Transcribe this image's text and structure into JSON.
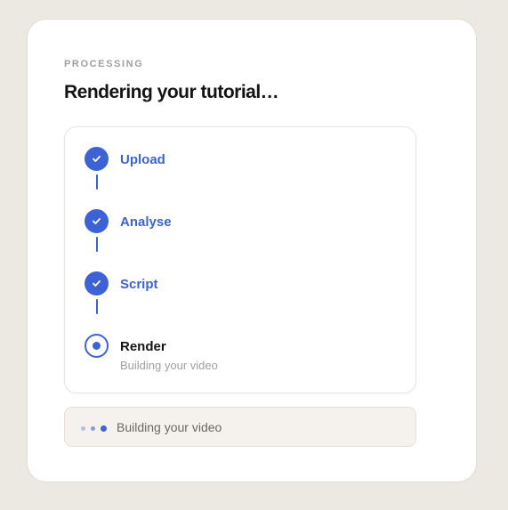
{
  "header": {
    "eyebrow": "PROCESSING",
    "title": "Rendering your tutorial…"
  },
  "steps": [
    {
      "label": "Upload",
      "state": "done",
      "icon": "check-icon"
    },
    {
      "label": "Analyse",
      "state": "done",
      "icon": "check-icon"
    },
    {
      "label": "Script",
      "state": "done",
      "icon": "check-icon"
    },
    {
      "label": "Render",
      "state": "active",
      "icon": "radio-active-icon",
      "sublabel": "Building your video"
    }
  ],
  "status": {
    "text": "Building your video",
    "icon": "loading-dots-icon"
  },
  "colors": {
    "accent": "#3c62d6",
    "background": "#ece8e2",
    "card": "#ffffff",
    "status_bg": "#f5f2ed"
  }
}
